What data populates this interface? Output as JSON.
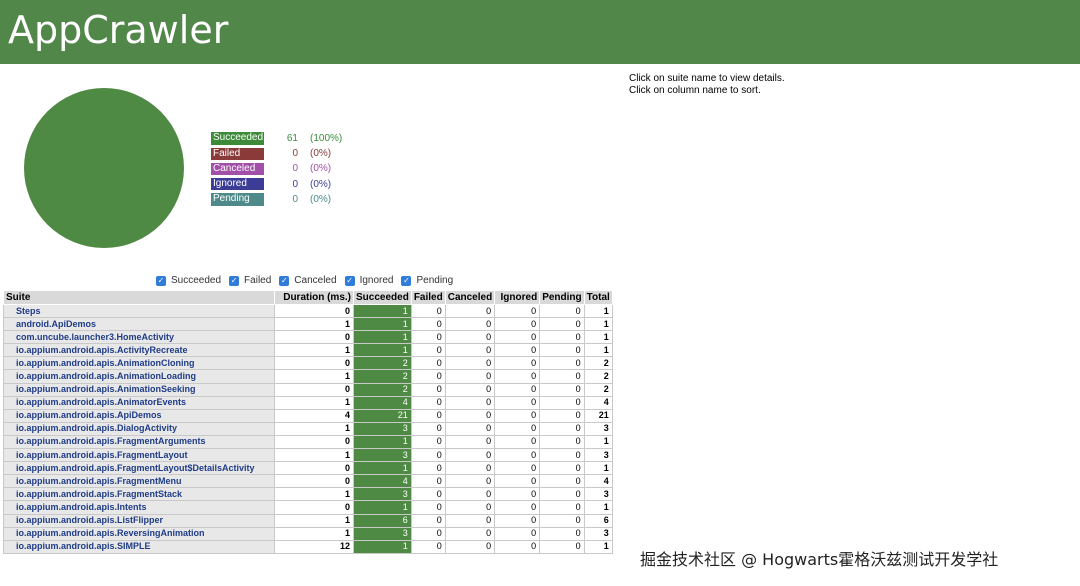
{
  "app": {
    "title": "AppCrawler"
  },
  "instructions": [
    "Click on suite name to view details.",
    "Click on column name to sort."
  ],
  "summary": [
    {
      "label": "Succeeded",
      "count": "61",
      "pct": "(100%)",
      "color": "#3d8a38",
      "text_color": "#3b8a3b"
    },
    {
      "label": "Failed",
      "count": "0",
      "pct": "(0%)",
      "color": "#8b3a3a",
      "text_color": "#8b3a3a"
    },
    {
      "label": "Canceled",
      "count": "0",
      "pct": "(0%)",
      "color": "#a24fa8",
      "text_color": "#a24fa8"
    },
    {
      "label": "Ignored",
      "count": "0",
      "pct": "(0%)",
      "color": "#3c3c96",
      "text_color": "#3c3c96"
    },
    {
      "label": "Pending",
      "count": "0",
      "pct": "(0%)",
      "color": "#4f8a8a",
      "text_color": "#4f8a8a"
    }
  ],
  "filters": [
    "Succeeded",
    "Failed",
    "Canceled",
    "Ignored",
    "Pending"
  ],
  "table": {
    "headers": [
      "Suite",
      "Duration (ms.)",
      "Succeeded",
      "Failed",
      "Canceled",
      "Ignored",
      "Pending",
      "Total"
    ],
    "rows": [
      [
        "Steps",
        "0",
        "1",
        "0",
        "0",
        "0",
        "0",
        "1"
      ],
      [
        "android.ApiDemos",
        "1",
        "1",
        "0",
        "0",
        "0",
        "0",
        "1"
      ],
      [
        "com.uncube.launcher3.HomeActivity",
        "0",
        "1",
        "0",
        "0",
        "0",
        "0",
        "1"
      ],
      [
        "io.appium.android.apis.ActivityRecreate",
        "1",
        "1",
        "0",
        "0",
        "0",
        "0",
        "1"
      ],
      [
        "io.appium.android.apis.AnimationCloning",
        "0",
        "2",
        "0",
        "0",
        "0",
        "0",
        "2"
      ],
      [
        "io.appium.android.apis.AnimationLoading",
        "1",
        "2",
        "0",
        "0",
        "0",
        "0",
        "2"
      ],
      [
        "io.appium.android.apis.AnimationSeeking",
        "0",
        "2",
        "0",
        "0",
        "0",
        "0",
        "2"
      ],
      [
        "io.appium.android.apis.AnimatorEvents",
        "1",
        "4",
        "0",
        "0",
        "0",
        "0",
        "4"
      ],
      [
        "io.appium.android.apis.ApiDemos",
        "4",
        "21",
        "0",
        "0",
        "0",
        "0",
        "21"
      ],
      [
        "io.appium.android.apis.DialogActivity",
        "1",
        "3",
        "0",
        "0",
        "0",
        "0",
        "3"
      ],
      [
        "io.appium.android.apis.FragmentArguments",
        "0",
        "1",
        "0",
        "0",
        "0",
        "0",
        "1"
      ],
      [
        "io.appium.android.apis.FragmentLayout",
        "1",
        "3",
        "0",
        "0",
        "0",
        "0",
        "3"
      ],
      [
        "io.appium.android.apis.FragmentLayout$DetailsActivity",
        "0",
        "1",
        "0",
        "0",
        "0",
        "0",
        "1"
      ],
      [
        "io.appium.android.apis.FragmentMenu",
        "0",
        "4",
        "0",
        "0",
        "0",
        "0",
        "4"
      ],
      [
        "io.appium.android.apis.FragmentStack",
        "1",
        "3",
        "0",
        "0",
        "0",
        "0",
        "3"
      ],
      [
        "io.appium.android.apis.Intents",
        "0",
        "1",
        "0",
        "0",
        "0",
        "0",
        "1"
      ],
      [
        "io.appium.android.apis.ListFlipper",
        "1",
        "6",
        "0",
        "0",
        "0",
        "0",
        "6"
      ],
      [
        "io.appium.android.apis.ReversingAnimation",
        "1",
        "3",
        "0",
        "0",
        "0",
        "0",
        "3"
      ],
      [
        "io.appium.android.apis.SIMPLE",
        "12",
        "1",
        "0",
        "0",
        "0",
        "0",
        "1"
      ]
    ]
  },
  "watermark": "掘金技术社区 @ Hogwarts霍格沃兹测试开发学社"
}
